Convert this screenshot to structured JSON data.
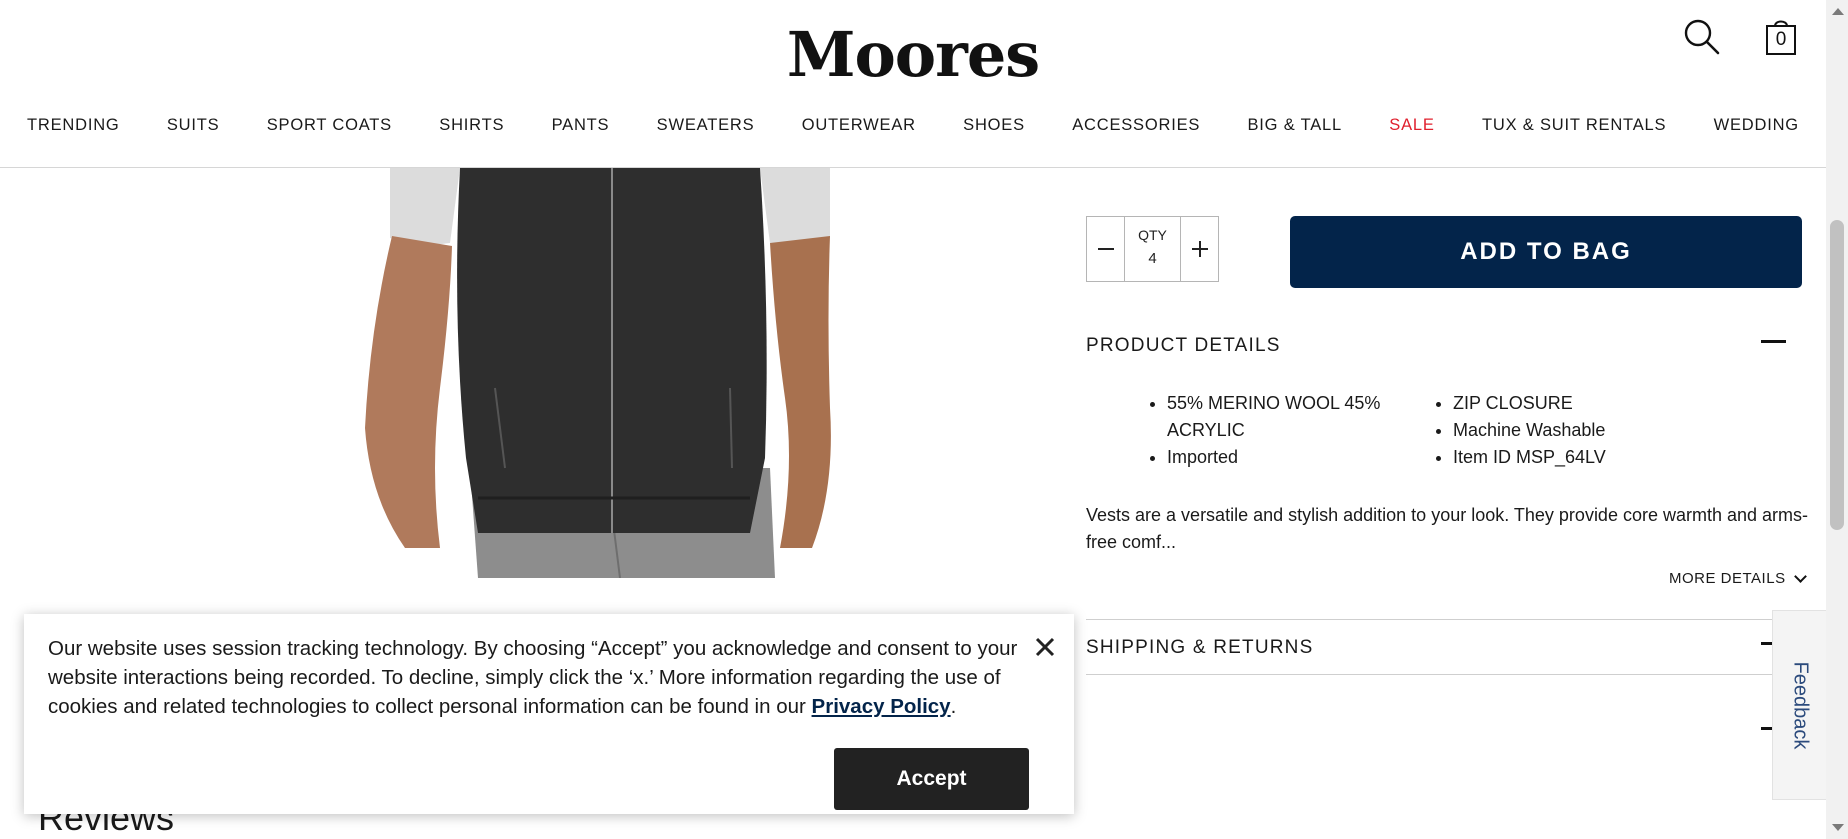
{
  "header": {
    "logo": "Moores",
    "bag_count": "0"
  },
  "nav": [
    {
      "label": "TRENDING"
    },
    {
      "label": "SUITS"
    },
    {
      "label": "SPORT COATS"
    },
    {
      "label": "SHIRTS"
    },
    {
      "label": "PANTS"
    },
    {
      "label": "SWEATERS"
    },
    {
      "label": "OUTERWEAR"
    },
    {
      "label": "SHOES"
    },
    {
      "label": "ACCESSORIES"
    },
    {
      "label": "BIG & TALL"
    },
    {
      "label": "SALE",
      "color": "#e0202e"
    },
    {
      "label": "TUX & SUIT RENTALS"
    },
    {
      "label": "WEDDING"
    }
  ],
  "purchase": {
    "qty_label": "QTY",
    "qty_value": "4",
    "add_to_bag": "ADD TO BAG"
  },
  "product_details": {
    "heading": "PRODUCT DETAILS",
    "bullets_left": [
      "55% MERINO WOOL 45% ACRYLIC",
      "Imported"
    ],
    "bullets_right": [
      "ZIP CLOSURE",
      "Machine Washable",
      "Item ID MSP_64LV"
    ],
    "description": "Vests are a versatile and stylish addition to your look. They provide core warmth and arms-free comf...",
    "more_details": "MORE DETAILS"
  },
  "shipping": {
    "heading": "SHIPPING & RETURNS"
  },
  "feedback": {
    "label": "Feedback"
  },
  "reviews": {
    "heading": "Reviews"
  },
  "cookie_banner": {
    "text": "Our website uses session tracking technology. By choosing “Accept” you acknowledge and consent to your website interactions being recorded. To decline, simply click the ‘x.’ More information regarding the use of cookies and related technologies to collect personal information can be found in our ",
    "link": "Privacy Policy",
    "link_suffix": ".",
    "accept": "Accept"
  },
  "colors": {
    "brand_navy": "#03244a",
    "sale_red": "#e0202e",
    "accept_bg": "#222222"
  }
}
